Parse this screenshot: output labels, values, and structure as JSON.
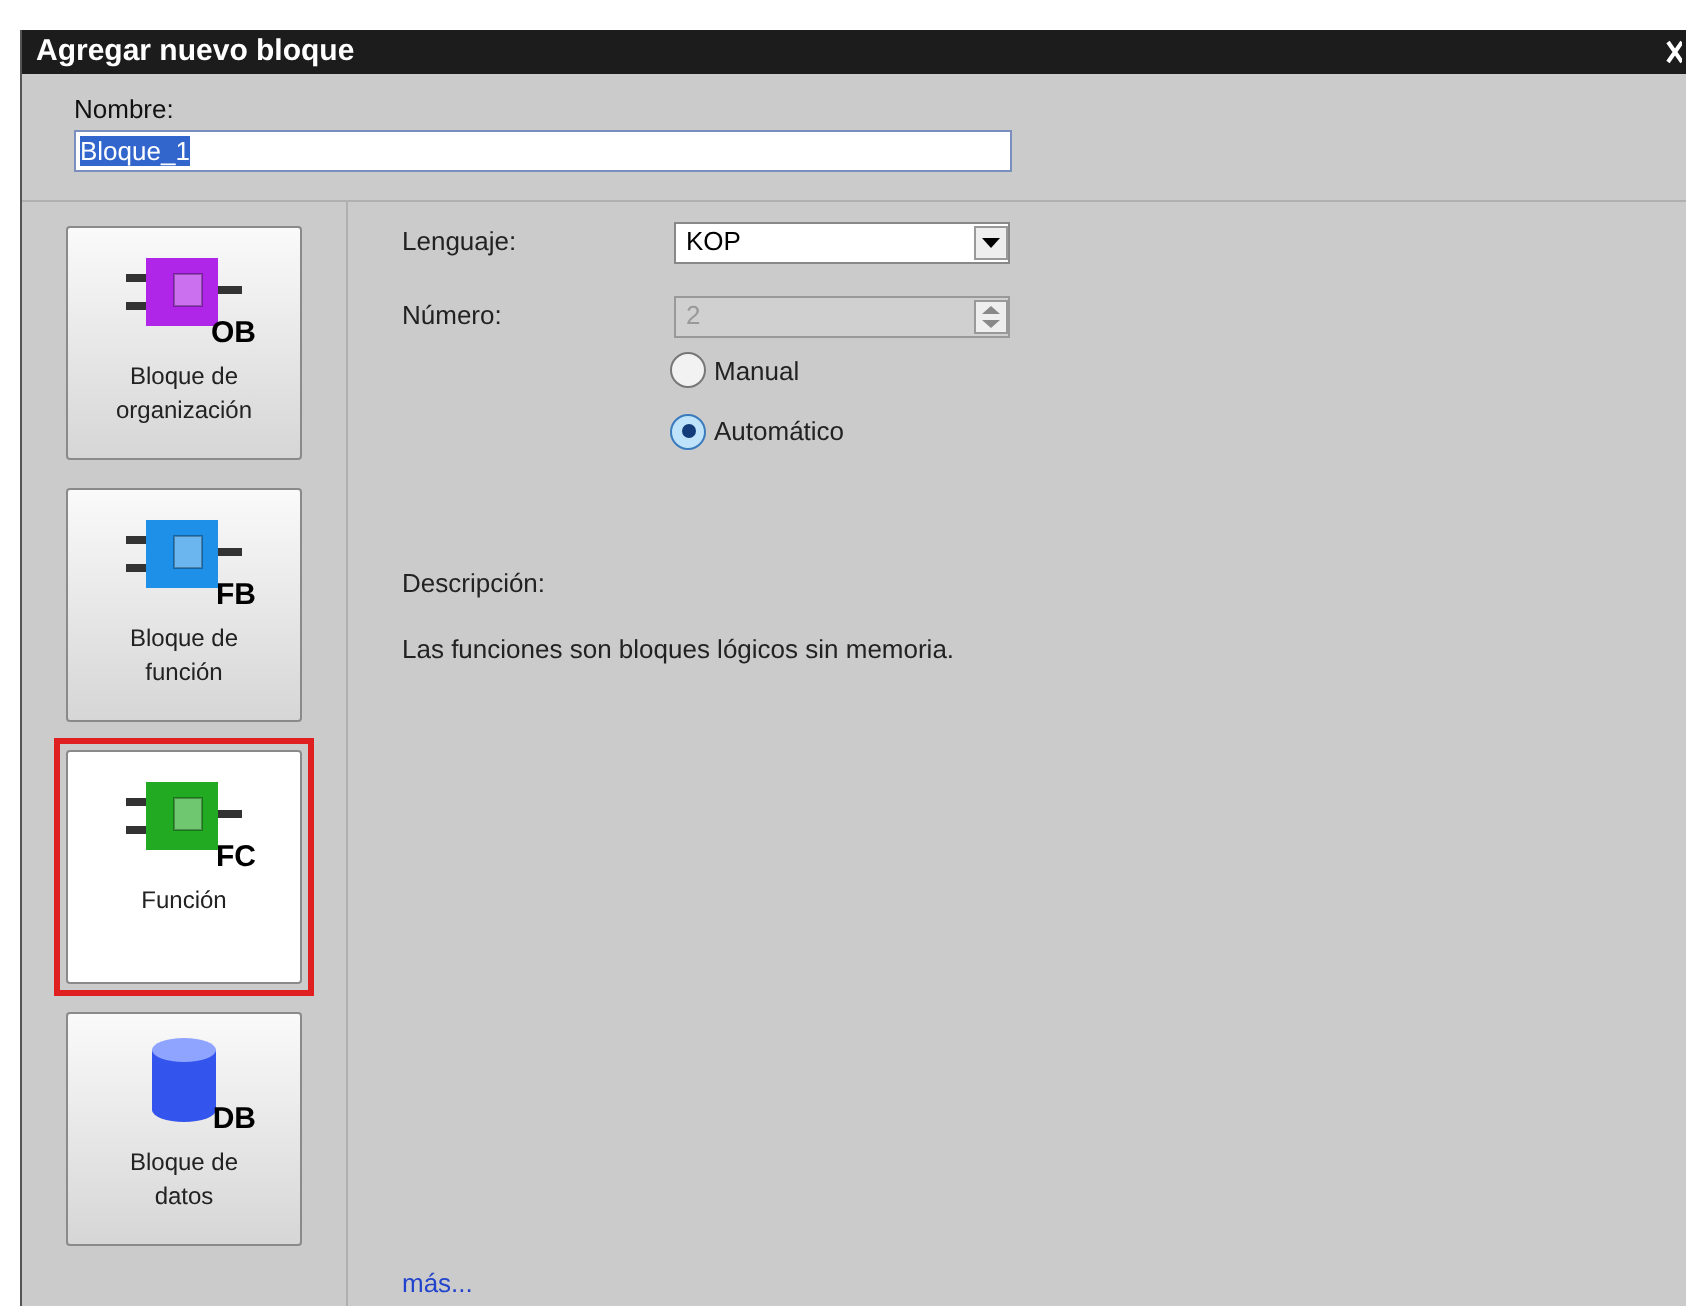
{
  "window": {
    "title": "Agregar nuevo bloque"
  },
  "name_field": {
    "label": "Nombre:",
    "value": "Bloque_1"
  },
  "block_types": [
    {
      "kind": "block",
      "badge": "OB",
      "label": "Bloque de organización",
      "color": "#b026e8",
      "selected": false
    },
    {
      "kind": "block",
      "badge": "FB",
      "label": "Bloque de función",
      "color": "#1e90e8",
      "selected": false
    },
    {
      "kind": "block",
      "badge": "FC",
      "label": "Función",
      "color": "#22aa22",
      "selected": true
    },
    {
      "kind": "database",
      "badge": "DB",
      "label": "Bloque de datos",
      "color": "#3355ee",
      "selected": false
    }
  ],
  "language": {
    "label": "Lenguaje:",
    "value": "KOP"
  },
  "number": {
    "label": "Número:",
    "value": "2",
    "disabled": true
  },
  "numbering": [
    {
      "label": "Manual",
      "selected": false
    },
    {
      "label": "Automático",
      "selected": true
    }
  ],
  "description": {
    "label": "Descripción:",
    "text": "Las funciones son bloques lógicos sin memoria."
  },
  "more_link": "más..."
}
